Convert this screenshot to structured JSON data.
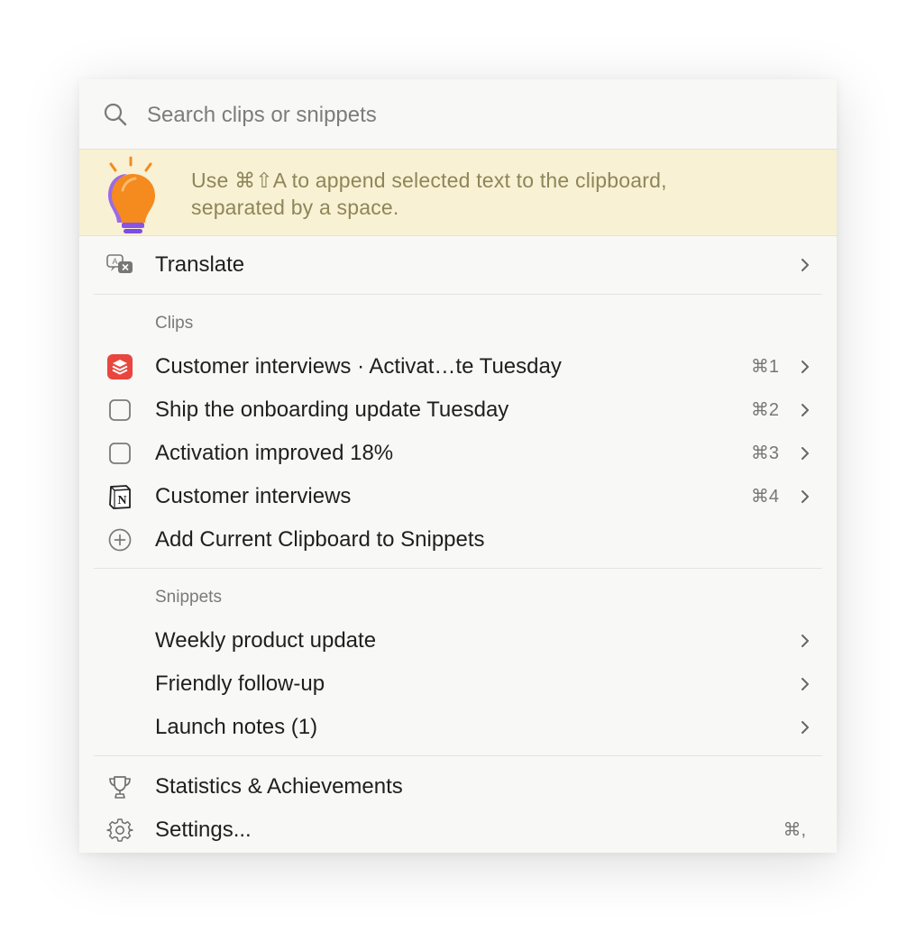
{
  "search": {
    "placeholder": "Search clips or snippets",
    "value": ""
  },
  "tip": {
    "line1": "Use ⌘⇧A to append selected text to the clipboard,",
    "line2": "separated by a space."
  },
  "actions": {
    "translate_label": "Translate"
  },
  "clips": {
    "header": "Clips",
    "items": [
      {
        "label": "Customer interviews · Activat…te Tuesday",
        "shortcut": "⌘1",
        "icon": "app-stack-icon"
      },
      {
        "label": "Ship the onboarding update Tuesday",
        "shortcut": "⌘2",
        "icon": "checkbox-icon"
      },
      {
        "label": "Activation improved 18%",
        "shortcut": "⌘3",
        "icon": "checkbox-icon"
      },
      {
        "label": "Customer interviews",
        "shortcut": "⌘4",
        "icon": "notion-icon"
      }
    ],
    "add_label": "Add Current Clipboard to Snippets"
  },
  "snippets": {
    "header": "Snippets",
    "items": [
      {
        "label": "Weekly product update"
      },
      {
        "label": "Friendly follow-up"
      },
      {
        "label": "Launch notes (1)"
      }
    ]
  },
  "footer": {
    "stats_label": "Statistics & Achievements",
    "settings_label": "Settings...",
    "settings_shortcut": "⌘,"
  },
  "colors": {
    "tip_background": "#f8f1d4",
    "tip_text": "#8f8558",
    "bulb": "#f58a1f",
    "bulb_base": "#7b4de0",
    "clip_icon": "#e8463e"
  }
}
